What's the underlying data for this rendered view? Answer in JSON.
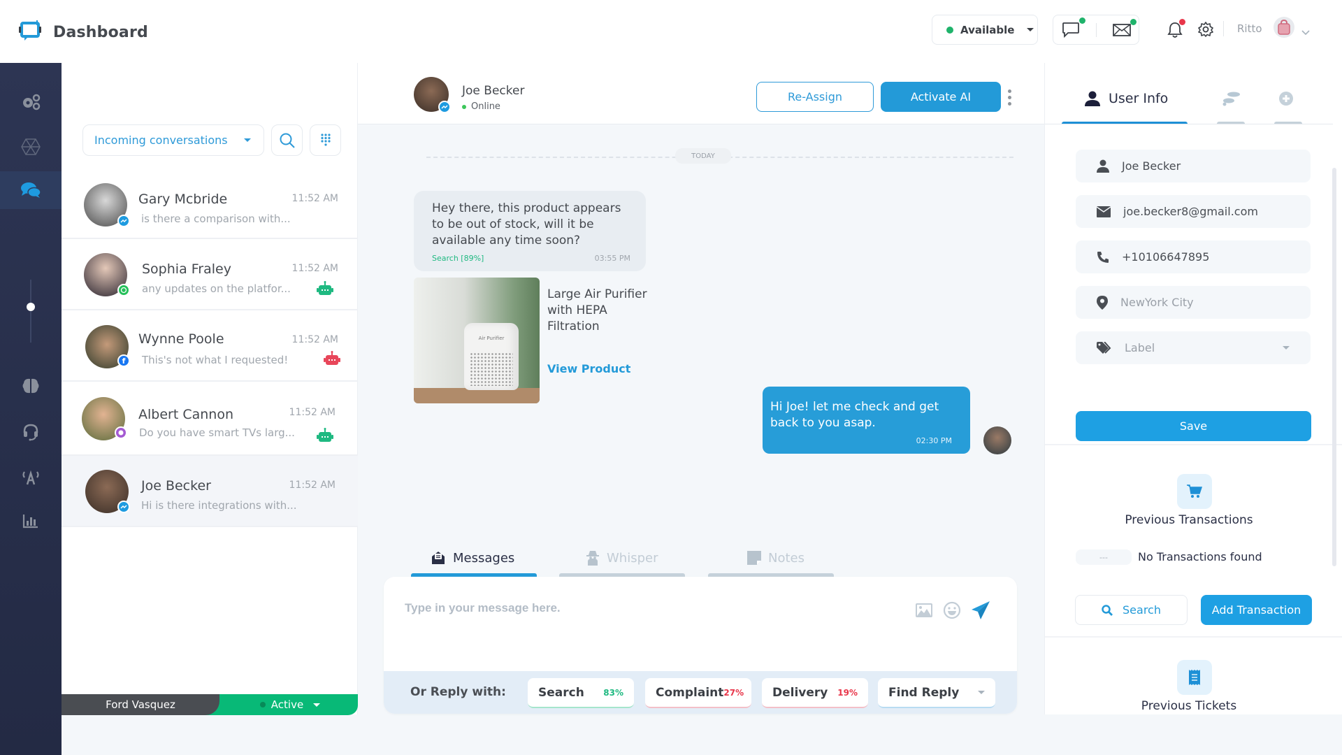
{
  "header": {
    "app_title": "Dashboard",
    "availability": "Available",
    "availability_color": "#1fb36b",
    "chat_badge_color": "#1fb36b",
    "mail_badge_color": "#1fb36b",
    "notification_badge_color": "#e8364a",
    "user_name": "Ritto"
  },
  "left_nav": {
    "items": [
      {
        "icon": "gears-icon",
        "active": false
      },
      {
        "icon": "hexagon-network-icon",
        "active": false
      },
      {
        "icon": "chat-bubbles-icon",
        "active": true
      },
      {
        "icon": "brain-icon",
        "active": false
      },
      {
        "icon": "headset-icon",
        "active": false
      },
      {
        "icon": "broadcast-antenna-icon",
        "active": false
      },
      {
        "icon": "bar-chart-icon",
        "active": false
      }
    ]
  },
  "conversations": {
    "filter": "Incoming conversations",
    "items": [
      {
        "name": "Gary Mcbride",
        "time": "11:52 AM",
        "preview": "is there a comparison with...",
        "channel": "messenger",
        "bot": null,
        "selected": false
      },
      {
        "name": "Sophia Fraley",
        "time": "11:52 AM",
        "preview": "any updates on the platfor...",
        "channel": "whatsapp",
        "bot": "green",
        "selected": false
      },
      {
        "name": "Wynne Poole",
        "time": "11:52 AM",
        "preview": "This's not what I requested!",
        "channel": "facebook",
        "bot": "red",
        "selected": false
      },
      {
        "name": "Albert Cannon",
        "time": "11:52 AM",
        "preview": "Do you have smart TVs larg...",
        "channel": "web",
        "bot": "green",
        "selected": false
      },
      {
        "name": "Joe Becker",
        "time": "11:52 AM",
        "preview": "Hi is there integrations with...",
        "channel": "messenger",
        "bot": null,
        "selected": true
      }
    ],
    "agent": {
      "name": "Ford Vasquez",
      "status": "Active"
    }
  },
  "chat": {
    "contact_name": "Joe Becker",
    "contact_status": "Online",
    "reassign_label": "Re-Assign",
    "activate_ai_label": "Activate AI",
    "date_divider": "TODAY",
    "messages": [
      {
        "direction": "in",
        "text": "Hey there, this product appears to be out of stock, will it be available any time soon?",
        "intent": "Search  [89%]",
        "time": "03:55 PM"
      },
      {
        "direction": "out",
        "text": "Hi Joe! let me check and get back to you asap.",
        "time": "02:30 PM"
      }
    ],
    "product": {
      "image_label": "Air Purifier",
      "title": "Large Air Purifier with HEPA Filtration",
      "link_label": "View Product"
    },
    "compose_tabs": [
      {
        "label": "Messages",
        "active": true
      },
      {
        "label": "Whisper",
        "active": false
      },
      {
        "label": "Notes",
        "active": false
      }
    ],
    "compose_placeholder": "Type in your message here.",
    "quick_reply_label": "Or Reply with:",
    "quick_replies": [
      {
        "label": "Search",
        "pct": "83%",
        "color": "#1fb981"
      },
      {
        "label": "Complaint",
        "pct": "27%",
        "color": "#e8364a"
      },
      {
        "label": "Delivery",
        "pct": "19%",
        "color": "#e8364a"
      },
      {
        "label": "Find Reply",
        "pct": "",
        "color": "#a8b3bd"
      }
    ]
  },
  "user_info": {
    "tabs": [
      {
        "label": "User Info",
        "icon": "user-icon",
        "active": true
      },
      {
        "label": "",
        "icon": "footsteps-icon",
        "active": false
      },
      {
        "label": "",
        "icon": "plus-circle-icon",
        "active": false
      }
    ],
    "name": "Joe Becker",
    "email": "joe.becker8@gmail.com",
    "phone": "+10106647895",
    "location_placeholder": "NewYork City",
    "label_placeholder": "Label",
    "save_label": "Save",
    "transactions_title": "Previous Transactions",
    "transactions_dash": "---",
    "transactions_empty": "No Transactions found",
    "search_label": "Search",
    "add_transaction_label": "Add Transaction",
    "tickets_title": "Previous Tickets"
  }
}
